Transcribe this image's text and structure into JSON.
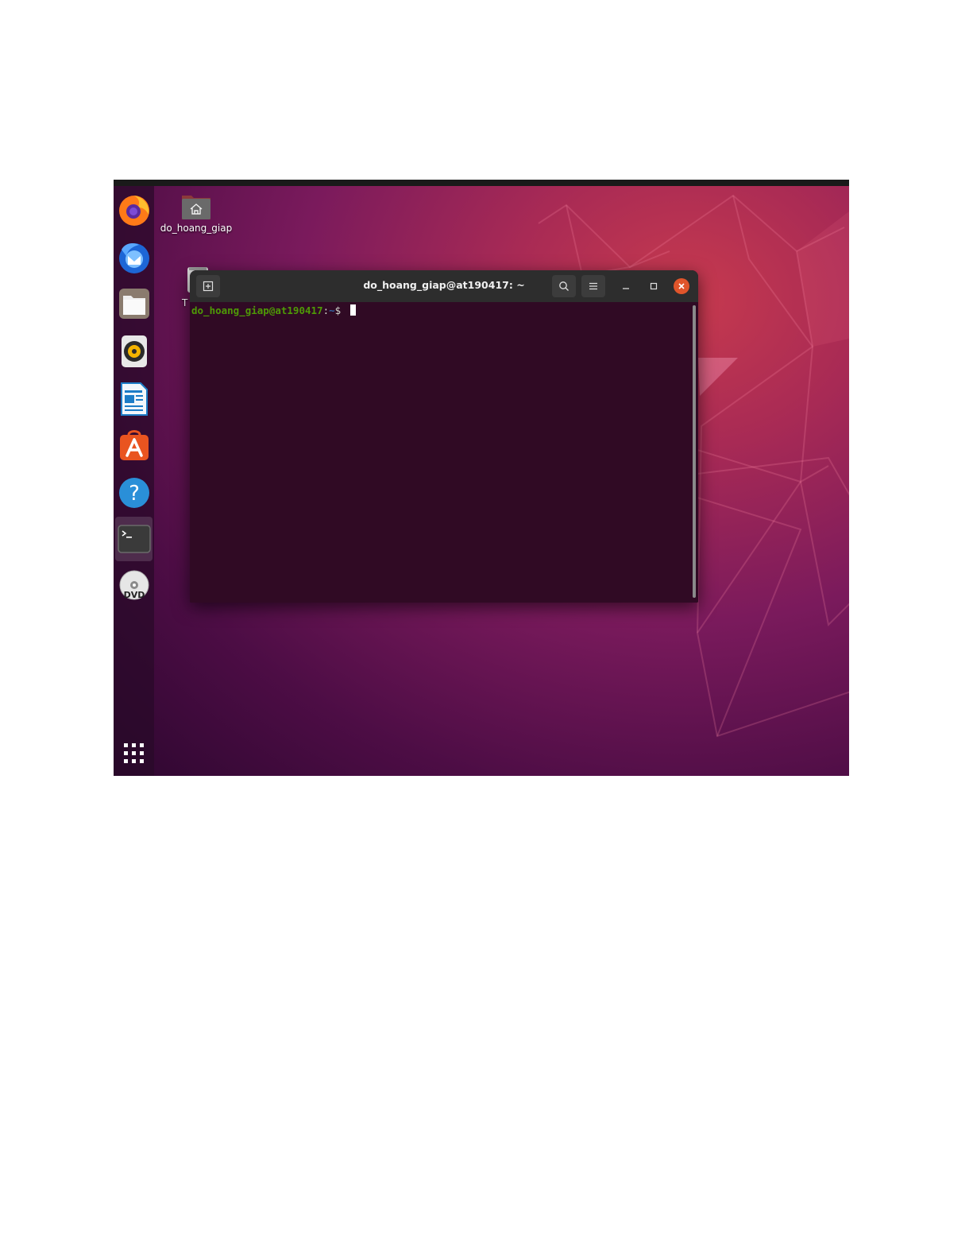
{
  "desktop": {
    "home_folder_label": "do_hoang_giap",
    "trash_label_partial": "T"
  },
  "dock": {
    "items": [
      {
        "icon": "firefox-icon"
      },
      {
        "icon": "thunderbird-icon"
      },
      {
        "icon": "files-icon"
      },
      {
        "icon": "rhythmbox-icon"
      },
      {
        "icon": "libreoffice-writer-icon"
      },
      {
        "icon": "ubuntu-software-icon"
      },
      {
        "icon": "help-icon"
      },
      {
        "icon": "terminal-icon",
        "active": true
      },
      {
        "icon": "dvd-icon"
      },
      {
        "icon": "show-applications-icon"
      }
    ],
    "dvd_text": "DVD"
  },
  "terminal": {
    "title": "do_hoang_giap@at190417: ~",
    "prompt_user": "do_hoang_giap@at190417",
    "prompt_sep": ":",
    "prompt_path": "~",
    "prompt_dollar": "$",
    "colors": {
      "background": "#300a24",
      "user": "#4e9a06",
      "path": "#3465a4",
      "close": "#e0552b"
    }
  }
}
